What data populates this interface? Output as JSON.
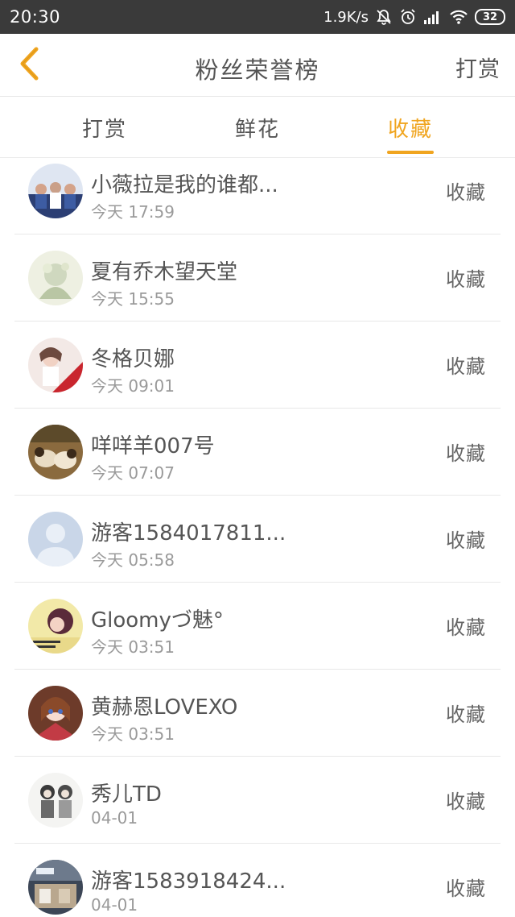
{
  "status_bar": {
    "time": "20:30",
    "net_speed": "1.9K/s",
    "battery": "32",
    "icons": [
      "mute-icon",
      "alarm-icon",
      "signal-icon",
      "wifi-icon",
      "battery-icon"
    ]
  },
  "header": {
    "back_icon": "chevron-left-icon",
    "title": "粉丝荣誉榜",
    "action_label": "打赏"
  },
  "tabs": [
    {
      "label": "打赏",
      "active": false
    },
    {
      "label": "鲜花",
      "active": false
    },
    {
      "label": "收藏",
      "active": true
    }
  ],
  "accent_color": "#f0a520",
  "list": [
    {
      "name": "小薇拉是我的谁都...",
      "time": "今天 17:59",
      "action": "收藏"
    },
    {
      "name": "夏有乔木望天堂",
      "time": "今天 15:55",
      "action": "收藏"
    },
    {
      "name": "冬格贝娜",
      "time": "今天 09:01",
      "action": "收藏"
    },
    {
      "name": "咩咩羊007号",
      "time": "今天 07:07",
      "action": "收藏"
    },
    {
      "name": "游客1584017811...",
      "time": "今天 05:58",
      "action": "收藏"
    },
    {
      "name": "Gloomyづ魅°",
      "time": "今天 03:51",
      "action": "收藏"
    },
    {
      "name": "黄赫恩LOVEXO",
      "time": "今天 03:51",
      "action": "收藏"
    },
    {
      "name": "秀儿TD",
      "time": "04-01",
      "action": "收藏"
    },
    {
      "name": "游客1583918424...",
      "time": "04-01",
      "action": "收藏"
    }
  ]
}
